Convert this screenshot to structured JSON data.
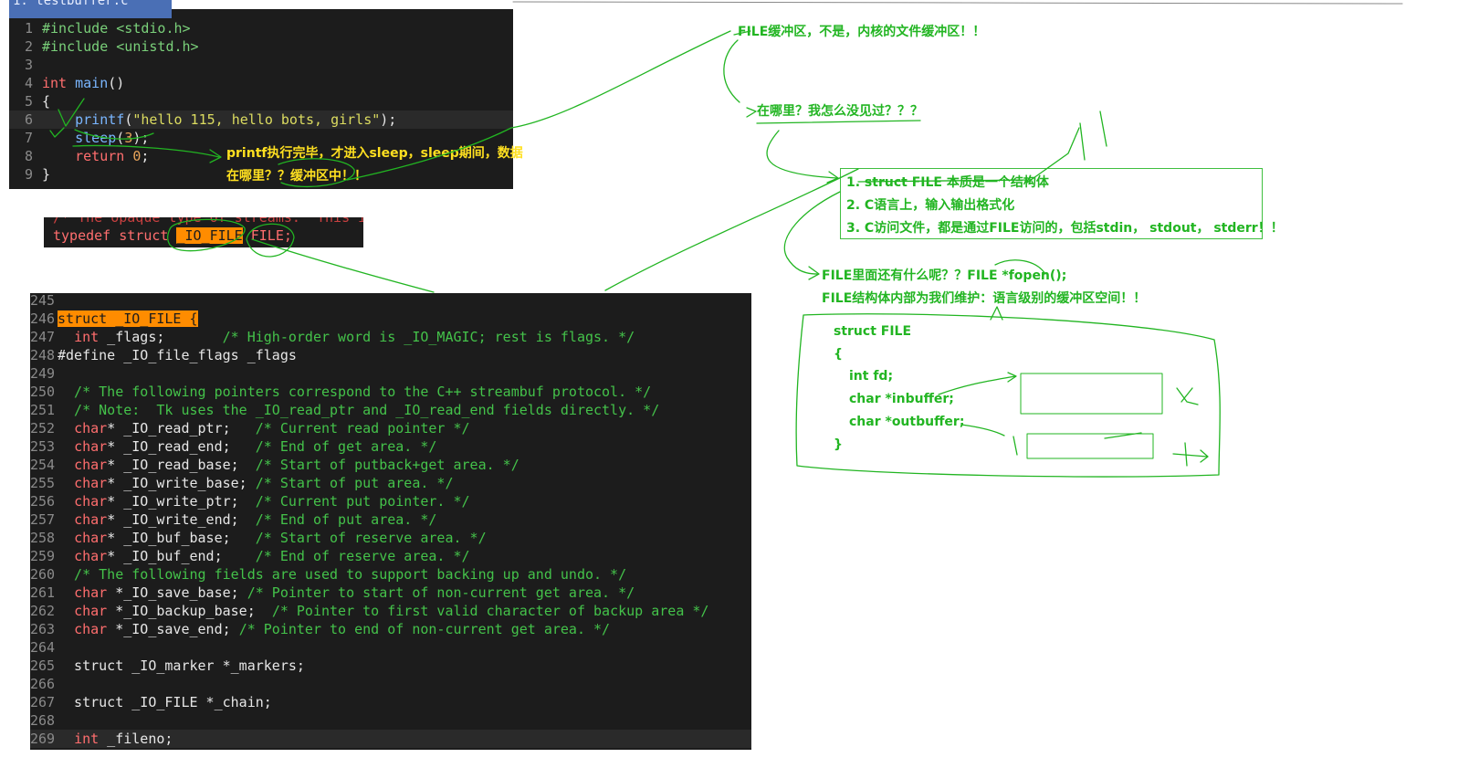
{
  "editor1": {
    "tab": "1: testbuffer.c",
    "lines": [
      {
        "n": "1",
        "parts": [
          [
            "inc",
            "#include <stdio.h>"
          ]
        ]
      },
      {
        "n": "2",
        "parts": [
          [
            "inc",
            "#include <unistd.h>"
          ]
        ]
      },
      {
        "n": "3",
        "parts": []
      },
      {
        "n": "4",
        "parts": [
          [
            "kw",
            "int "
          ],
          [
            "fn",
            "main"
          ],
          [
            "plain",
            "()"
          ]
        ]
      },
      {
        "n": "5",
        "parts": [
          [
            "plain",
            "{"
          ]
        ]
      },
      {
        "n": "6",
        "parts": [
          [
            "plain",
            "    "
          ],
          [
            "fn",
            "printf"
          ],
          [
            "plain",
            "("
          ],
          [
            "str",
            "\"hello 115, hello bots, girls\""
          ],
          [
            "plain",
            ");"
          ]
        ],
        "cur": true
      },
      {
        "n": "7",
        "parts": [
          [
            "plain",
            "    "
          ],
          [
            "fn",
            "sleep"
          ],
          [
            "plain",
            "("
          ],
          [
            "num",
            "3"
          ],
          [
            "plain",
            ");"
          ]
        ]
      },
      {
        "n": "8",
        "parts": [
          [
            "plain",
            "    "
          ],
          [
            "kw",
            "return "
          ],
          [
            "num",
            "0"
          ],
          [
            "plain",
            ";"
          ]
        ]
      },
      {
        "n": "9",
        "parts": [
          [
            "plain",
            "}"
          ]
        ]
      }
    ]
  },
  "editor2": {
    "comment": "/* The opaque type of streams.  This i",
    "typedef_kw": "typedef struct ",
    "typedef_name": "_IO_FILE",
    "typedef_rest": " FILE;"
  },
  "editor3": {
    "lines": [
      {
        "n": "245",
        "parts": []
      },
      {
        "n": "246",
        "parts": [
          [
            "hl",
            "struct _IO_FILE {"
          ]
        ]
      },
      {
        "n": "247",
        "parts": [
          [
            "plain",
            "  "
          ],
          [
            "type",
            "int"
          ],
          [
            "plain",
            " _flags;       "
          ],
          [
            "com",
            "/* High-order word is _IO_MAGIC; rest is flags. */"
          ]
        ]
      },
      {
        "n": "248",
        "parts": [
          [
            "plain",
            "#define _IO_file_flags _flags"
          ]
        ]
      },
      {
        "n": "249",
        "parts": []
      },
      {
        "n": "250",
        "parts": [
          [
            "com",
            "  /* The following pointers correspond to the C++ streambuf protocol. */"
          ]
        ]
      },
      {
        "n": "251",
        "parts": [
          [
            "com",
            "  /* Note:  Tk uses the _IO_read_ptr and _IO_read_end fields directly. */"
          ]
        ]
      },
      {
        "n": "252",
        "parts": [
          [
            "plain",
            "  "
          ],
          [
            "type",
            "char"
          ],
          [
            "plain",
            "* _IO_read_ptr;   "
          ],
          [
            "com",
            "/* Current read pointer */"
          ]
        ]
      },
      {
        "n": "253",
        "parts": [
          [
            "plain",
            "  "
          ],
          [
            "type",
            "char"
          ],
          [
            "plain",
            "* _IO_read_end;   "
          ],
          [
            "com",
            "/* End of get area. */"
          ]
        ]
      },
      {
        "n": "254",
        "parts": [
          [
            "plain",
            "  "
          ],
          [
            "type",
            "char"
          ],
          [
            "plain",
            "* _IO_read_base;  "
          ],
          [
            "com",
            "/* Start of putback+get area. */"
          ]
        ]
      },
      {
        "n": "255",
        "parts": [
          [
            "plain",
            "  "
          ],
          [
            "type",
            "char"
          ],
          [
            "plain",
            "* _IO_write_base; "
          ],
          [
            "com",
            "/* Start of put area. */"
          ]
        ]
      },
      {
        "n": "256",
        "parts": [
          [
            "plain",
            "  "
          ],
          [
            "type",
            "char"
          ],
          [
            "plain",
            "* _IO_write_ptr;  "
          ],
          [
            "com",
            "/* Current put pointer. */"
          ]
        ]
      },
      {
        "n": "257",
        "parts": [
          [
            "plain",
            "  "
          ],
          [
            "type",
            "char"
          ],
          [
            "plain",
            "* _IO_write_end;  "
          ],
          [
            "com",
            "/* End of put area. */"
          ]
        ]
      },
      {
        "n": "258",
        "parts": [
          [
            "plain",
            "  "
          ],
          [
            "type",
            "char"
          ],
          [
            "plain",
            "* _IO_buf_base;   "
          ],
          [
            "com",
            "/* Start of reserve area. */"
          ]
        ]
      },
      {
        "n": "259",
        "parts": [
          [
            "plain",
            "  "
          ],
          [
            "type",
            "char"
          ],
          [
            "plain",
            "* _IO_buf_end;    "
          ],
          [
            "com",
            "/* End of reserve area. */"
          ]
        ]
      },
      {
        "n": "260",
        "parts": [
          [
            "com",
            "  /* The following fields are used to support backing up and undo. */"
          ]
        ]
      },
      {
        "n": "261",
        "parts": [
          [
            "plain",
            "  "
          ],
          [
            "type",
            "char"
          ],
          [
            "plain",
            " *_IO_save_base; "
          ],
          [
            "com",
            "/* Pointer to start of non-current get area. */"
          ]
        ]
      },
      {
        "n": "262",
        "parts": [
          [
            "plain",
            "  "
          ],
          [
            "type",
            "char"
          ],
          [
            "plain",
            " *_IO_backup_base;  "
          ],
          [
            "com",
            "/* Pointer to first valid character of backup area */"
          ]
        ]
      },
      {
        "n": "263",
        "parts": [
          [
            "plain",
            "  "
          ],
          [
            "type",
            "char"
          ],
          [
            "plain",
            " *_IO_save_end; "
          ],
          [
            "com",
            "/* Pointer to end of non-current get area. */"
          ]
        ]
      },
      {
        "n": "264",
        "parts": []
      },
      {
        "n": "265",
        "parts": [
          [
            "plain",
            "  struct _IO_marker *_markers;"
          ]
        ]
      },
      {
        "n": "266",
        "parts": []
      },
      {
        "n": "267",
        "parts": [
          [
            "plain",
            "  struct _IO_FILE *_chain;"
          ]
        ]
      },
      {
        "n": "268",
        "parts": []
      },
      {
        "n": "269",
        "parts": [
          [
            "plain",
            "  "
          ],
          [
            "type",
            "int"
          ],
          [
            "plain",
            " _fileno;"
          ]
        ],
        "cur": true
      }
    ]
  },
  "annotations": {
    "a1": "printf执行完毕，才进入sleep，sleep期间，数据",
    "a2": "在哪里？？缓冲区中！！",
    "a3": "FILE缓冲区，不是，内核的文件缓冲区！！",
    "a4": "在哪里？我怎么没见过？？？",
    "box1": [
      "1. struct FILE 本质是一个结构体",
      "2. C语言上，输入输出格式化",
      "3. C访问文件，都是通过FILE访问的，包括stdin， stdout， stderr！！"
    ],
    "a5": "FILE里面还有什么呢？？FILE *fopen();",
    "a6": "FILE结构体内部为我们维护：语言级别的缓冲区空间！！",
    "struct_lines": [
      "struct FILE",
      "{",
      "int fd;",
      "char *inbuffer;",
      "char *outbuffer;",
      "}"
    ]
  },
  "colors": {
    "accent": "#22b522",
    "highlight": "#ff8c00",
    "editor_bg": "#1c1c1c"
  }
}
